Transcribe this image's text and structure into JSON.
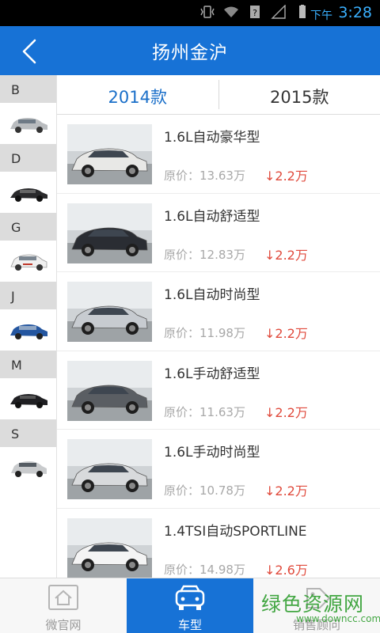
{
  "status": {
    "ampm": "下午",
    "time": "3:28"
  },
  "header": {
    "title": "扬州金沪"
  },
  "sidebar": {
    "groups": [
      {
        "letter": "B"
      },
      {
        "letter": "D"
      },
      {
        "letter": "G"
      },
      {
        "letter": "J"
      },
      {
        "letter": "M"
      },
      {
        "letter": "S"
      }
    ]
  },
  "tabs": [
    {
      "label": "2014款"
    },
    {
      "label": "2015款"
    }
  ],
  "list": [
    {
      "name": "1.6L自动豪华型",
      "price": "原价：13.63万",
      "drop": "↓2.2万",
      "car_color": "#e8e8e6"
    },
    {
      "name": "1.6L自动舒适型",
      "price": "原价：12.83万",
      "drop": "↓2.2万",
      "car_color": "#2a2d33"
    },
    {
      "name": "1.6L自动时尚型",
      "price": "原价：11.98万",
      "drop": "↓2.2万",
      "car_color": "#c7cbd0"
    },
    {
      "name": "1.6L手动舒适型",
      "price": "原价：11.63万",
      "drop": "↓2.2万",
      "car_color": "#5a5e63"
    },
    {
      "name": "1.6L手动时尚型",
      "price": "原价：10.78万",
      "drop": "↓2.2万",
      "car_color": "#d8dadc"
    },
    {
      "name": "1.4TSI自动SPORTLINE",
      "price": "原价：14.98万",
      "drop": "↓2.6万",
      "car_color": "#f4f4f4"
    }
  ],
  "nav": [
    {
      "label": "微官网",
      "icon": "home-icon"
    },
    {
      "label": "车型",
      "icon": "car-icon"
    },
    {
      "label": "销售顾问",
      "icon": "tag-icon"
    }
  ],
  "watermark": {
    "main": "绿色资源网",
    "sub": "www.downcc.com"
  },
  "colors": {
    "brand": "#1772d6",
    "price_drop": "#e04a3c",
    "tab_active": "#1a6fc9"
  }
}
